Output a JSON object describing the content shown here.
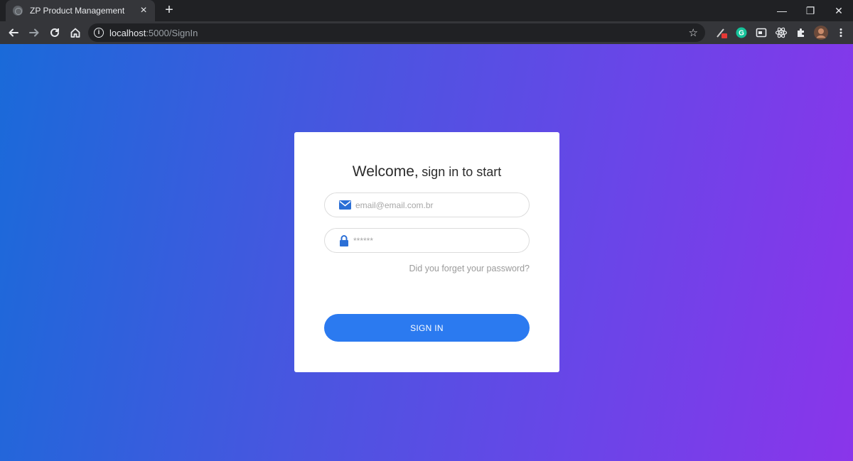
{
  "browser": {
    "tab_title": "ZP Product Management",
    "tab_close": "×",
    "new_tab": "+",
    "url_host": "localhost",
    "url_path": ":5000/SignIn",
    "window_controls": {
      "minimize": "—",
      "restore": "❐",
      "close": "✕"
    },
    "extensions": [
      "color-picker-icon",
      "grammarly-icon",
      "window-icon",
      "react-devtools-icon",
      "puzzle-icon",
      "avatar"
    ]
  },
  "signin": {
    "heading_big": "Welcome,",
    "heading_small": "sign in to start",
    "email_placeholder": "email@email.com.br",
    "password_placeholder": "******",
    "forgot_link": "Did you forget your password?",
    "submit_label": "SIGN IN"
  },
  "colors": {
    "accent": "#2b7af0",
    "gradient_start": "#1a6ad9",
    "gradient_end": "#8a35ea"
  }
}
